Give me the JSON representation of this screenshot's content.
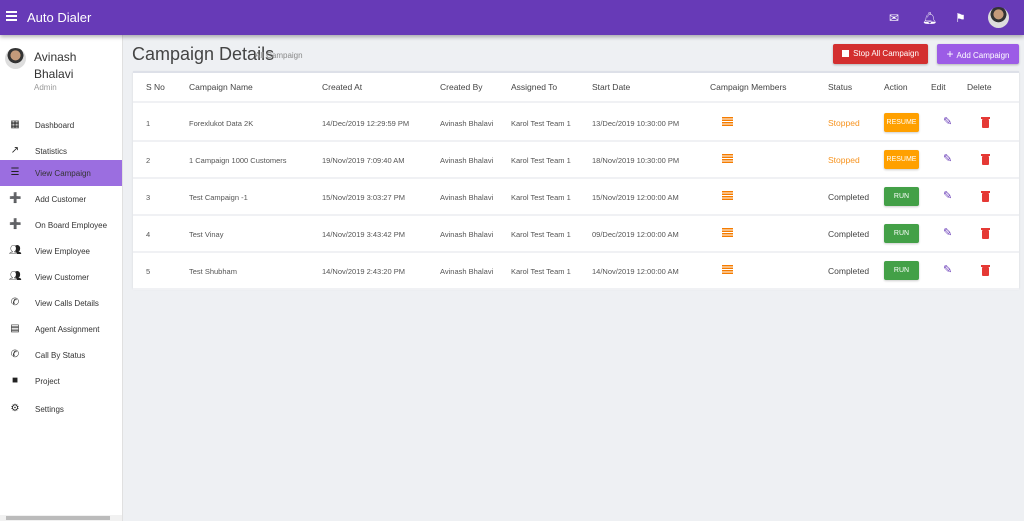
{
  "app": {
    "title": "Auto Dialer"
  },
  "topbar": {
    "icons": [
      "mail-icon",
      "bell-icon",
      "flag-icon",
      "user-avatar"
    ]
  },
  "user": {
    "name": "Avinash Bhalavi",
    "role": "Admin"
  },
  "sidebar": {
    "items": [
      {
        "label": "Dashboard",
        "icon": "dashboard-icon"
      },
      {
        "label": "Statistics",
        "icon": "trending-up-icon"
      },
      {
        "label": "View Campaign",
        "icon": "list-icon",
        "active": true
      },
      {
        "label": "Add Customer",
        "icon": "person-add-icon"
      },
      {
        "label": "On Board Employee",
        "icon": "person-add-icon"
      },
      {
        "label": "View Employee",
        "icon": "people-icon"
      },
      {
        "label": "View Customer",
        "icon": "people-icon"
      },
      {
        "label": "View Calls Details",
        "icon": "phone-icon"
      },
      {
        "label": "Agent Assignment",
        "icon": "assignment-icon"
      },
      {
        "label": "Call By Status",
        "icon": "phone-icon"
      },
      {
        "label": "Project",
        "icon": "briefcase-icon"
      },
      {
        "label": "Settings",
        "icon": "gear-icon"
      }
    ]
  },
  "page": {
    "title": "Campaign Details",
    "subtitle": "All Campaign",
    "stop_all_label": "Stop All Campaign",
    "add_label": "Add Campaign"
  },
  "table": {
    "headers": [
      "S No",
      "Campaign Name",
      "Created At",
      "Created By",
      "Assigned To",
      "Start Date",
      "Campaign Members",
      "Status",
      "Action",
      "Edit",
      "Delete"
    ],
    "rows": [
      {
        "sno": "1",
        "name": "Forexlukot Data 2K",
        "created_at": "14/Dec/2019 12:29:59 PM",
        "created_by": "Avinash Bhalavi",
        "assigned_to": "Karol Test Team 1",
        "start_date": "13/Dec/2019 10:30:00 PM",
        "status": "Stopped",
        "action": "RESUME"
      },
      {
        "sno": "2",
        "name": "1 Campaign 1000 Customers",
        "created_at": "19/Nov/2019 7:09:40 AM",
        "created_by": "Avinash Bhalavi",
        "assigned_to": "Karol Test Team 1",
        "start_date": "18/Nov/2019 10:30:00 PM",
        "status": "Stopped",
        "action": "RESUME"
      },
      {
        "sno": "3",
        "name": "Test Campaign -1",
        "created_at": "15/Nov/2019 3:03:27 PM",
        "created_by": "Avinash Bhalavi",
        "assigned_to": "Karol Test Team 1",
        "start_date": "15/Nov/2019 12:00:00 AM",
        "status": "Completed",
        "action": "RUN"
      },
      {
        "sno": "4",
        "name": "Test Vinay",
        "created_at": "14/Nov/2019 3:43:42 PM",
        "created_by": "Avinash Bhalavi",
        "assigned_to": "Karol Test Team 1",
        "start_date": "09/Dec/2019 12:00:00 AM",
        "status": "Completed",
        "action": "RUN"
      },
      {
        "sno": "5",
        "name": "Test Shubham",
        "created_at": "14/Nov/2019 2:43:20 PM",
        "created_by": "Avinash Bhalavi",
        "assigned_to": "Karol Test Team 1",
        "start_date": "14/Nov/2019 12:00:00 AM",
        "status": "Completed",
        "action": "RUN"
      }
    ]
  },
  "colors": {
    "primary": "#673ab7",
    "stopped": "#f7931e",
    "resume": "#ffa000",
    "run": "#43a047",
    "stop_all": "#d32f2f",
    "add": "#9c4fe0",
    "delete": "#e53935"
  }
}
